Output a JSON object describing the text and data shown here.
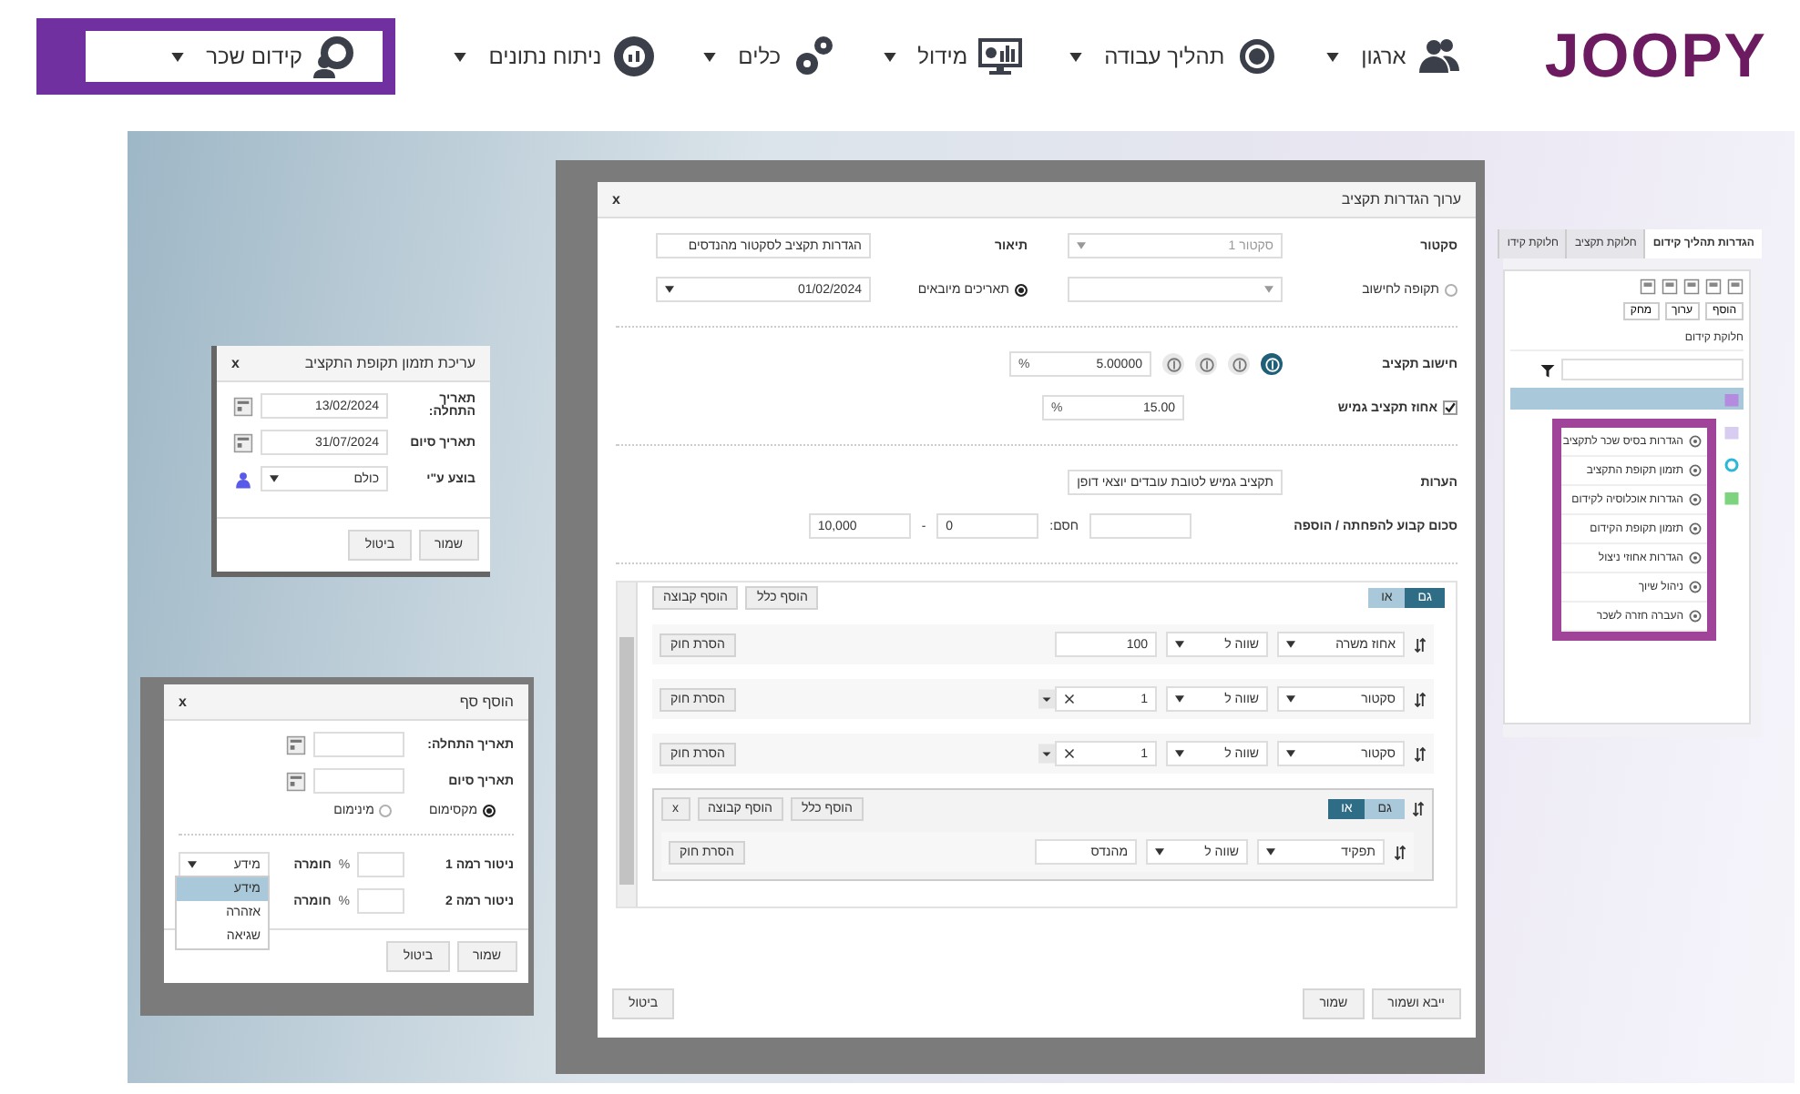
{
  "nav": {
    "logo": "JOOPY",
    "items": [
      {
        "label": "ארגון",
        "selected": false
      },
      {
        "label": "תהליך עבודה",
        "selected": false
      },
      {
        "label": "מידול",
        "selected": false
      },
      {
        "label": "כלים",
        "selected": false
      },
      {
        "label": "ניתוח נתונים",
        "selected": false
      },
      {
        "label": "קידום שכר",
        "selected": true
      }
    ]
  },
  "budget_dialog": {
    "title": "ערוך הגדרות תקציב",
    "close": "x",
    "sector": {
      "label": "סקטור",
      "value": "סקטור 1",
      "disabled": true
    },
    "description": {
      "label": "תיאור",
      "value": "הגדרות תקציב לסקטור מהנדסים"
    },
    "period": {
      "label": "תקופה לחישוב",
      "selected": false
    },
    "imported": {
      "label": "תאריכים מיובאים",
      "selected": true,
      "value": "01/02/2024"
    },
    "calc": {
      "label": "חישוב תקציב",
      "modes": [
        {
          "selected": true
        },
        {
          "selected": false
        },
        {
          "selected": false
        },
        {
          "selected": false
        }
      ],
      "value": "5.00000",
      "unit": "%"
    },
    "flex": {
      "label": "אחוז תקציב גמיש",
      "checked": true,
      "value": "15.00",
      "unit": "%"
    },
    "notes": {
      "label": "הערות",
      "value": "תקציב גמיש לטובת עובדים יוצאי דופן"
    },
    "fixed": {
      "label": "סכום קבוע להפחתה / הוספה",
      "bound_label": "חסם:",
      "from": "0",
      "dash": "-",
      "to": "10,000"
    },
    "rules": {
      "combinator": [
        {
          "label": "גם",
          "selected": true
        },
        {
          "label": "או",
          "selected": false
        }
      ],
      "add_rule": "הוסף כלל",
      "add_group": "הוסף קבוצה",
      "items": [
        {
          "kind": "number",
          "field": "אחוז משרה",
          "operator": "שווה ל",
          "value": "100",
          "remove": "הסרת חוק"
        },
        {
          "kind": "select",
          "field": "סקטור",
          "operator": "שווה ל",
          "value": "1",
          "remove": "הסרת חוק"
        },
        {
          "kind": "select",
          "field": "סקטור",
          "operator": "שווה ל",
          "value": "1",
          "remove": "הסרת חוק"
        }
      ],
      "group": {
        "combinator": [
          {
            "label": "גם",
            "selected": false
          },
          {
            "label": "או",
            "selected": true
          }
        ],
        "add_rule": "הוסף כלל",
        "add_group": "הוסף קבוצה",
        "close": "x",
        "items": [
          {
            "field": "תפקיד",
            "operator": "שווה ל",
            "value": "מהנדס",
            "remove": "הסרת חוק"
          }
        ]
      }
    },
    "buttons": [
      "ייבא ושמור",
      "שמור",
      "ביטול"
    ]
  },
  "schedule_dialog": {
    "title": "עריכת תזמון תקופת התקציב",
    "close": "x",
    "fields": [
      {
        "kind": "date",
        "label": "תאריך התחלה:",
        "value": "13/02/2024"
      },
      {
        "kind": "date",
        "label": "תאריך סיום",
        "value": "31/07/2024"
      },
      {
        "kind": "user",
        "label": "בוצע ע\"י",
        "value": "כולם"
      }
    ],
    "buttons": [
      "שמור",
      "ביטול"
    ]
  },
  "threshold_dialog": {
    "title": "הוסף סף",
    "close": "x",
    "dates": [
      {
        "label": "תאריך התחלה:"
      },
      {
        "label": "תאריך סיום"
      }
    ],
    "radios": [
      {
        "label": "מקסימום",
        "selected": true
      },
      {
        "label": "מינימום",
        "selected": false
      }
    ],
    "levels": [
      {
        "label": "ניטור רמה 1",
        "unit": "%",
        "severity_label": "חומרה",
        "severity": "מידע"
      },
      {
        "label": "ניטור רמה 2",
        "unit": "%",
        "severity_label": "חומרה"
      }
    ],
    "dropdown": [
      {
        "label": "מידע",
        "selected": true
      },
      {
        "label": "אזהרה",
        "selected": false
      },
      {
        "label": "שגיאה",
        "selected": false
      }
    ],
    "buttons": [
      "שמור",
      "ביטול"
    ]
  },
  "process_panel": {
    "tabs": [
      {
        "label": "הגדרות תהליך קידום",
        "selected": true
      },
      {
        "label": "חלוקת תקציב",
        "selected": false
      },
      {
        "label": "חלוקת קידו",
        "selected": false
      }
    ],
    "actions": [
      "הוסף",
      "ערוך",
      "מחק"
    ],
    "list_title": "חלוקת קידום",
    "menu": [
      "הגדרות בסיס שכר לתקציב",
      "תזמון תקופת התקציב",
      "הגדרות אוכלוסיה לקידום",
      "תזמון תקופת הקידום",
      "הגדרות אחוזי ניצול",
      "ניהול שיוך",
      "העברה חזרה לשכר"
    ]
  }
}
